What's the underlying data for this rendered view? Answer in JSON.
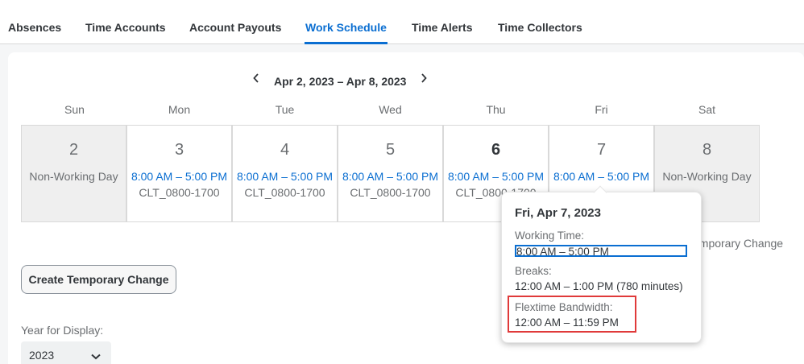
{
  "tabs": [
    {
      "label": "Absences",
      "active": false
    },
    {
      "label": "Time Accounts",
      "active": false
    },
    {
      "label": "Account Payouts",
      "active": false
    },
    {
      "label": "Work Schedule",
      "active": true
    },
    {
      "label": "Time Alerts",
      "active": false
    },
    {
      "label": "Time Collectors",
      "active": false
    }
  ],
  "calendar": {
    "range_label": "Apr 2, 2023 – Apr 8, 2023",
    "prev_icon": "chevron-left-icon",
    "next_icon": "chevron-right-icon",
    "days": [
      {
        "name": "Sun",
        "date": "2",
        "type": "non-working",
        "text": "Non-Working Day"
      },
      {
        "name": "Mon",
        "date": "3",
        "type": "working",
        "time": "8:00 AM – 5:00 PM",
        "code": "CLT_0800-1700"
      },
      {
        "name": "Tue",
        "date": "4",
        "type": "working",
        "time": "8:00 AM – 5:00 PM",
        "code": "CLT_0800-1700"
      },
      {
        "name": "Wed",
        "date": "5",
        "type": "working",
        "time": "8:00 AM – 5:00 PM",
        "code": "CLT_0800-1700"
      },
      {
        "name": "Thu",
        "date": "6",
        "type": "working",
        "time": "8:00 AM – 5:00 PM",
        "code": "CLT_0800-1700",
        "today": true
      },
      {
        "name": "Fri",
        "date": "7",
        "type": "working",
        "time": "8:00 AM – 5:00 PM"
      },
      {
        "name": "Sat",
        "date": "8",
        "type": "non-working",
        "text": "Non-Working Day"
      }
    ]
  },
  "legend_partial": "emporary Change",
  "create_button": "Create Temporary Change",
  "year": {
    "label": "Year for Display:",
    "value": "2023",
    "icon": "chevron-down-icon"
  },
  "popover": {
    "title": "Fri, Apr 7, 2023",
    "working_time_label": "Working Time:",
    "working_time_value": "8:00 AM – 5:00 PM",
    "breaks_label": "Breaks:",
    "breaks_value": "12:00 AM – 1:00 PM (780 minutes)",
    "flextime_label": "Flextime Bandwidth:",
    "flextime_value": "12:00 AM – 11:59 PM"
  },
  "colors": {
    "accent": "#0a6ed1",
    "highlight": "#e03a3a",
    "weekend_bg": "#efefef"
  }
}
